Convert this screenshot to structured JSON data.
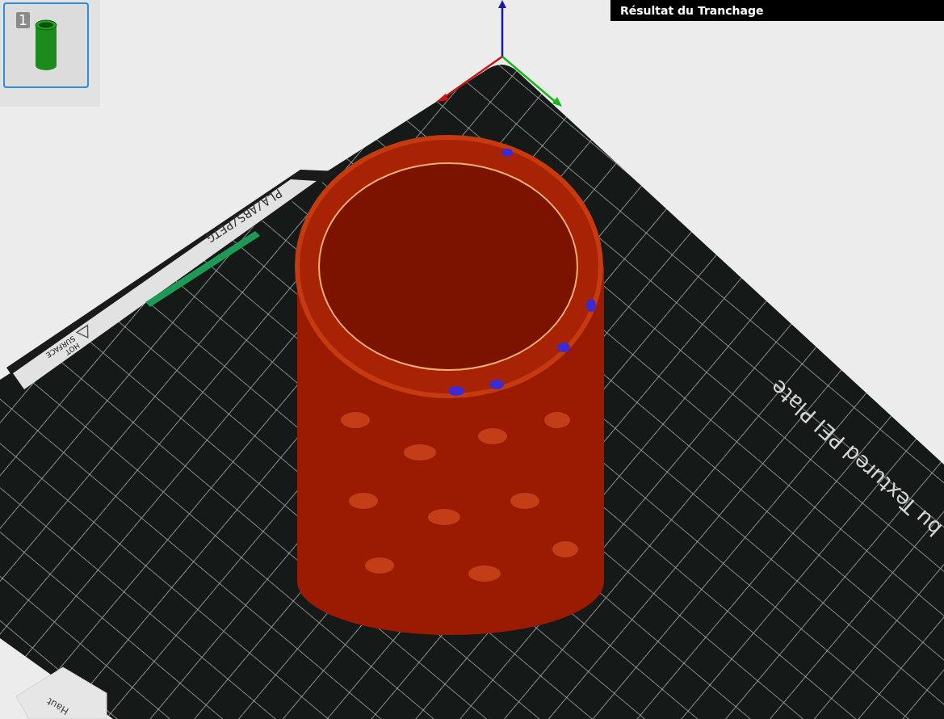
{
  "panel": {
    "title": "Résultat du Tranchage"
  },
  "plates": [
    {
      "label": "1",
      "selected": true
    }
  ],
  "build_plate": {
    "material_label": "PLA/ABS/PETG",
    "warning_label": [
      "HOT",
      "SURFACE"
    ],
    "plate_name": "bu Textured PEI Plate"
  },
  "view_cube": {
    "face_label": "Haut"
  }
}
